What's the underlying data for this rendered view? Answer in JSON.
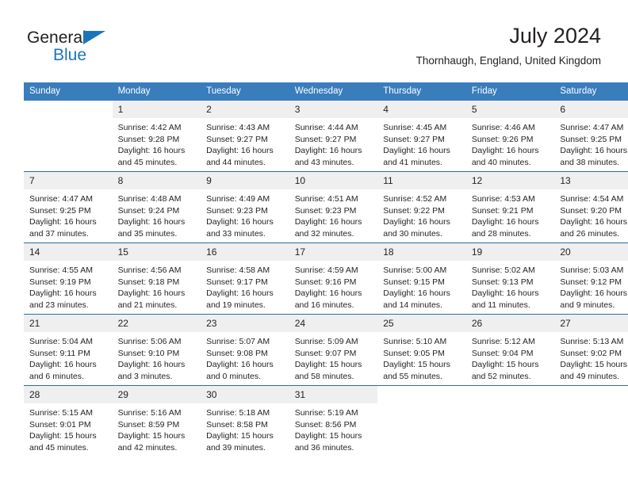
{
  "brand": {
    "name_part1": "General",
    "name_part2": "Blue",
    "accent_color": "#1b75bb"
  },
  "header": {
    "title": "July 2024",
    "subtitle": "Thornhaugh, England, United Kingdom"
  },
  "theme": {
    "header_row_bg": "#3a7dbd",
    "daynum_bg": "#efefef",
    "separator": "#2a6da8",
    "text": "#231f20"
  },
  "calendar": {
    "weekday_headers": [
      "Sunday",
      "Monday",
      "Tuesday",
      "Wednesday",
      "Thursday",
      "Friday",
      "Saturday"
    ],
    "weeks": [
      [
        {
          "day": "",
          "sunrise": "",
          "sunset": "",
          "daylight1": "",
          "daylight2": "",
          "empty": true
        },
        {
          "day": "1",
          "sunrise": "Sunrise: 4:42 AM",
          "sunset": "Sunset: 9:28 PM",
          "daylight1": "Daylight: 16 hours",
          "daylight2": "and 45 minutes."
        },
        {
          "day": "2",
          "sunrise": "Sunrise: 4:43 AM",
          "sunset": "Sunset: 9:27 PM",
          "daylight1": "Daylight: 16 hours",
          "daylight2": "and 44 minutes."
        },
        {
          "day": "3",
          "sunrise": "Sunrise: 4:44 AM",
          "sunset": "Sunset: 9:27 PM",
          "daylight1": "Daylight: 16 hours",
          "daylight2": "and 43 minutes."
        },
        {
          "day": "4",
          "sunrise": "Sunrise: 4:45 AM",
          "sunset": "Sunset: 9:27 PM",
          "daylight1": "Daylight: 16 hours",
          "daylight2": "and 41 minutes."
        },
        {
          "day": "5",
          "sunrise": "Sunrise: 4:46 AM",
          "sunset": "Sunset: 9:26 PM",
          "daylight1": "Daylight: 16 hours",
          "daylight2": "and 40 minutes."
        },
        {
          "day": "6",
          "sunrise": "Sunrise: 4:47 AM",
          "sunset": "Sunset: 9:25 PM",
          "daylight1": "Daylight: 16 hours",
          "daylight2": "and 38 minutes."
        }
      ],
      [
        {
          "day": "7",
          "sunrise": "Sunrise: 4:47 AM",
          "sunset": "Sunset: 9:25 PM",
          "daylight1": "Daylight: 16 hours",
          "daylight2": "and 37 minutes."
        },
        {
          "day": "8",
          "sunrise": "Sunrise: 4:48 AM",
          "sunset": "Sunset: 9:24 PM",
          "daylight1": "Daylight: 16 hours",
          "daylight2": "and 35 minutes."
        },
        {
          "day": "9",
          "sunrise": "Sunrise: 4:49 AM",
          "sunset": "Sunset: 9:23 PM",
          "daylight1": "Daylight: 16 hours",
          "daylight2": "and 33 minutes."
        },
        {
          "day": "10",
          "sunrise": "Sunrise: 4:51 AM",
          "sunset": "Sunset: 9:23 PM",
          "daylight1": "Daylight: 16 hours",
          "daylight2": "and 32 minutes."
        },
        {
          "day": "11",
          "sunrise": "Sunrise: 4:52 AM",
          "sunset": "Sunset: 9:22 PM",
          "daylight1": "Daylight: 16 hours",
          "daylight2": "and 30 minutes."
        },
        {
          "day": "12",
          "sunrise": "Sunrise: 4:53 AM",
          "sunset": "Sunset: 9:21 PM",
          "daylight1": "Daylight: 16 hours",
          "daylight2": "and 28 minutes."
        },
        {
          "day": "13",
          "sunrise": "Sunrise: 4:54 AM",
          "sunset": "Sunset: 9:20 PM",
          "daylight1": "Daylight: 16 hours",
          "daylight2": "and 26 minutes."
        }
      ],
      [
        {
          "day": "14",
          "sunrise": "Sunrise: 4:55 AM",
          "sunset": "Sunset: 9:19 PM",
          "daylight1": "Daylight: 16 hours",
          "daylight2": "and 23 minutes."
        },
        {
          "day": "15",
          "sunrise": "Sunrise: 4:56 AM",
          "sunset": "Sunset: 9:18 PM",
          "daylight1": "Daylight: 16 hours",
          "daylight2": "and 21 minutes."
        },
        {
          "day": "16",
          "sunrise": "Sunrise: 4:58 AM",
          "sunset": "Sunset: 9:17 PM",
          "daylight1": "Daylight: 16 hours",
          "daylight2": "and 19 minutes."
        },
        {
          "day": "17",
          "sunrise": "Sunrise: 4:59 AM",
          "sunset": "Sunset: 9:16 PM",
          "daylight1": "Daylight: 16 hours",
          "daylight2": "and 16 minutes."
        },
        {
          "day": "18",
          "sunrise": "Sunrise: 5:00 AM",
          "sunset": "Sunset: 9:15 PM",
          "daylight1": "Daylight: 16 hours",
          "daylight2": "and 14 minutes."
        },
        {
          "day": "19",
          "sunrise": "Sunrise: 5:02 AM",
          "sunset": "Sunset: 9:13 PM",
          "daylight1": "Daylight: 16 hours",
          "daylight2": "and 11 minutes."
        },
        {
          "day": "20",
          "sunrise": "Sunrise: 5:03 AM",
          "sunset": "Sunset: 9:12 PM",
          "daylight1": "Daylight: 16 hours",
          "daylight2": "and 9 minutes."
        }
      ],
      [
        {
          "day": "21",
          "sunrise": "Sunrise: 5:04 AM",
          "sunset": "Sunset: 9:11 PM",
          "daylight1": "Daylight: 16 hours",
          "daylight2": "and 6 minutes."
        },
        {
          "day": "22",
          "sunrise": "Sunrise: 5:06 AM",
          "sunset": "Sunset: 9:10 PM",
          "daylight1": "Daylight: 16 hours",
          "daylight2": "and 3 minutes."
        },
        {
          "day": "23",
          "sunrise": "Sunrise: 5:07 AM",
          "sunset": "Sunset: 9:08 PM",
          "daylight1": "Daylight: 16 hours",
          "daylight2": "and 0 minutes."
        },
        {
          "day": "24",
          "sunrise": "Sunrise: 5:09 AM",
          "sunset": "Sunset: 9:07 PM",
          "daylight1": "Daylight: 15 hours",
          "daylight2": "and 58 minutes."
        },
        {
          "day": "25",
          "sunrise": "Sunrise: 5:10 AM",
          "sunset": "Sunset: 9:05 PM",
          "daylight1": "Daylight: 15 hours",
          "daylight2": "and 55 minutes."
        },
        {
          "day": "26",
          "sunrise": "Sunrise: 5:12 AM",
          "sunset": "Sunset: 9:04 PM",
          "daylight1": "Daylight: 15 hours",
          "daylight2": "and 52 minutes."
        },
        {
          "day": "27",
          "sunrise": "Sunrise: 5:13 AM",
          "sunset": "Sunset: 9:02 PM",
          "daylight1": "Daylight: 15 hours",
          "daylight2": "and 49 minutes."
        }
      ],
      [
        {
          "day": "28",
          "sunrise": "Sunrise: 5:15 AM",
          "sunset": "Sunset: 9:01 PM",
          "daylight1": "Daylight: 15 hours",
          "daylight2": "and 45 minutes."
        },
        {
          "day": "29",
          "sunrise": "Sunrise: 5:16 AM",
          "sunset": "Sunset: 8:59 PM",
          "daylight1": "Daylight: 15 hours",
          "daylight2": "and 42 minutes."
        },
        {
          "day": "30",
          "sunrise": "Sunrise: 5:18 AM",
          "sunset": "Sunset: 8:58 PM",
          "daylight1": "Daylight: 15 hours",
          "daylight2": "and 39 minutes."
        },
        {
          "day": "31",
          "sunrise": "Sunrise: 5:19 AM",
          "sunset": "Sunset: 8:56 PM",
          "daylight1": "Daylight: 15 hours",
          "daylight2": "and 36 minutes."
        },
        {
          "day": "",
          "sunrise": "",
          "sunset": "",
          "daylight1": "",
          "daylight2": "",
          "empty": true
        },
        {
          "day": "",
          "sunrise": "",
          "sunset": "",
          "daylight1": "",
          "daylight2": "",
          "empty": true
        },
        {
          "day": "",
          "sunrise": "",
          "sunset": "",
          "daylight1": "",
          "daylight2": "",
          "empty": true
        }
      ]
    ]
  }
}
